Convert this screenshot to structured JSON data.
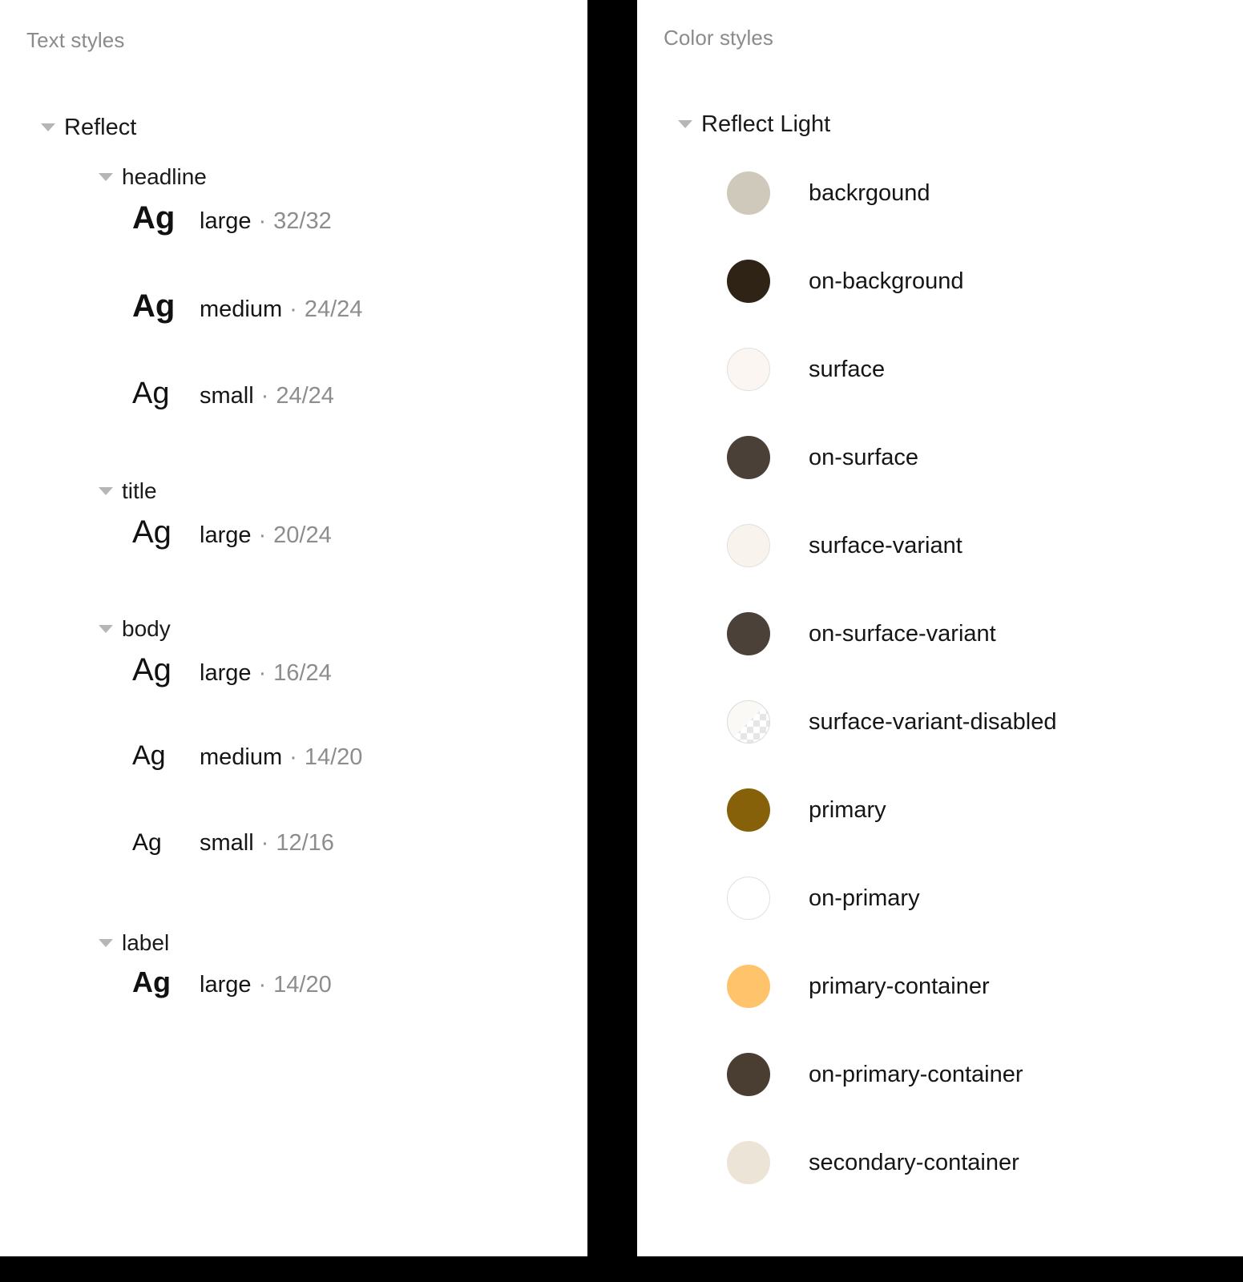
{
  "canvas": {
    "background": "#000000",
    "panel_background": "#ffffff"
  },
  "text_panel": {
    "title": "Text styles",
    "root": {
      "label": "Reflect",
      "caret": "chevron-down-icon"
    },
    "groups": [
      {
        "label": "headline",
        "caret": "chevron-down-icon",
        "styles": [
          {
            "preview": "Ag",
            "name": "large",
            "separator": "·",
            "metrics": "32/32"
          },
          {
            "preview": "Ag",
            "name": "medium",
            "separator": "·",
            "metrics": "24/24"
          },
          {
            "preview": "Ag",
            "name": "small",
            "separator": "·",
            "metrics": "24/24"
          }
        ]
      },
      {
        "label": "title",
        "caret": "chevron-down-icon",
        "styles": [
          {
            "preview": "Ag",
            "name": "large",
            "separator": "·",
            "metrics": "20/24"
          }
        ]
      },
      {
        "label": "body",
        "caret": "chevron-down-icon",
        "styles": [
          {
            "preview": "Ag",
            "name": "large",
            "separator": "·",
            "metrics": "16/24"
          },
          {
            "preview": "Ag",
            "name": "medium",
            "separator": "·",
            "metrics": "14/20"
          },
          {
            "preview": "Ag",
            "name": "small",
            "separator": "·",
            "metrics": "12/16"
          }
        ]
      },
      {
        "label": "label",
        "caret": "chevron-down-icon",
        "styles": [
          {
            "preview": "Ag",
            "name": "large",
            "separator": "·",
            "metrics": "14/20"
          }
        ]
      }
    ]
  },
  "color_panel": {
    "title": "Color styles",
    "root": {
      "label": "Reflect Light",
      "caret": "chevron-down-icon"
    },
    "colors": [
      {
        "name": "backrgound",
        "hex": "#CEC9BB",
        "style": "solid"
      },
      {
        "name": "on-background",
        "hex": "#2E2314",
        "style": "solid"
      },
      {
        "name": "surface",
        "hex": "#FBF6F1",
        "style": "hairline"
      },
      {
        "name": "on-surface",
        "hex": "#4A4037",
        "style": "solid"
      },
      {
        "name": "surface-variant",
        "hex": "#F9F3EE",
        "style": "hairline"
      },
      {
        "name": "on-surface-variant",
        "hex": "#4B4138",
        "style": "solid"
      },
      {
        "name": "surface-variant-disabled",
        "hex": "#F9F3EE",
        "style": "checker"
      },
      {
        "name": "primary",
        "hex": "#86610A",
        "style": "solid"
      },
      {
        "name": "on-primary",
        "hex": "#FFFFFF",
        "style": "hairline"
      },
      {
        "name": "primary-container",
        "hex": "#FFC46B",
        "style": "solid"
      },
      {
        "name": "on-primary-container",
        "hex": "#4A3E33",
        "style": "solid"
      },
      {
        "name": "secondary-container",
        "hex": "#EDE4D8",
        "style": "solid"
      }
    ]
  }
}
